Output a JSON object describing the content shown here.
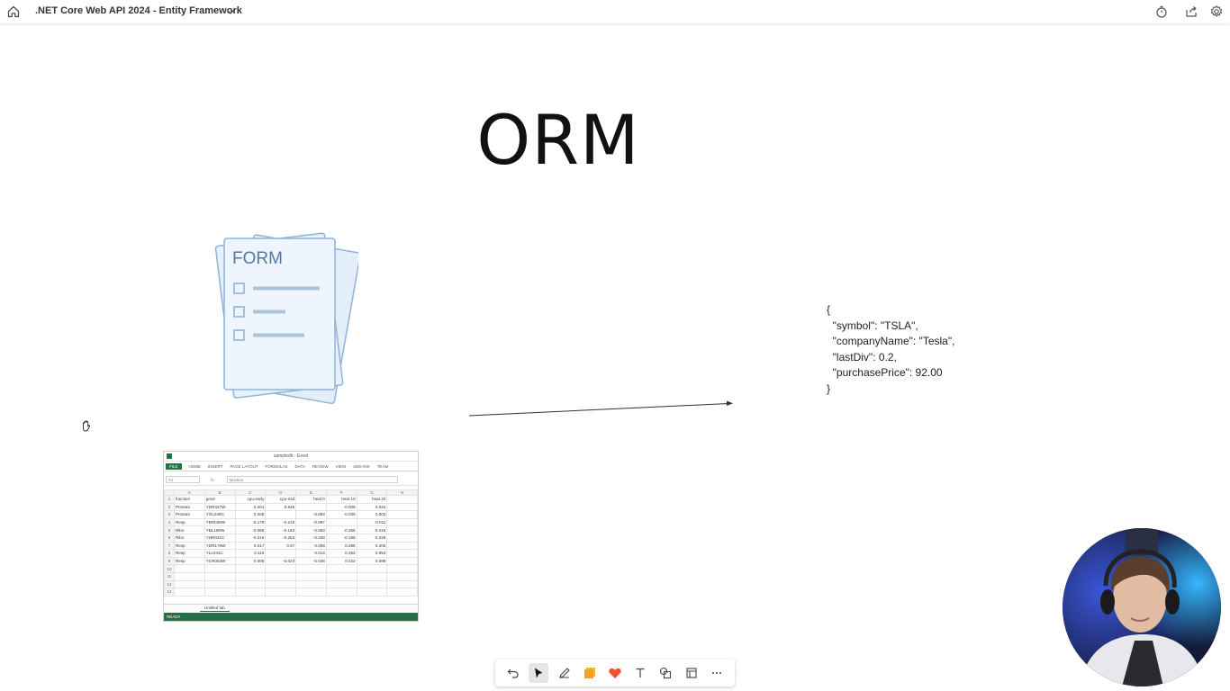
{
  "app": {
    "title": ".NET Core Web API 2024 - Entity Framework"
  },
  "icons": {
    "home": "home-icon",
    "title_dropdown": "chevron-down-icon",
    "timer": "timer-icon",
    "share": "share-icon",
    "settings": "gear-icon",
    "cursor": "hand-grab-cursor-icon"
  },
  "canvas": {
    "heading": "ORM",
    "form_illustration": {
      "label": "FORM"
    },
    "json_lines": [
      "{",
      "  \"symbol\": \"TSLA\",",
      "  \"companyName\": \"Tesla\",",
      "  \"lastDiv\": 0.2,",
      "  \"purchasePrice\": 92.00",
      "}"
    ],
    "excel": {
      "window_title": "sampledb - Excel",
      "ribbon_tabs": [
        "FILE",
        "HOME",
        "INSERT",
        "PAGE LAYOUT",
        "FORMULAS",
        "DATA",
        "REVIEW",
        "VIEW",
        "ADD-INS",
        "TEAM"
      ],
      "name_box": "A1",
      "formula": "function",
      "columns": [
        "A",
        "B",
        "C",
        "D",
        "E",
        "F",
        "G",
        "H"
      ],
      "rows": [
        [
          "function",
          "gene",
          "cpu-early",
          "cpu-mid",
          "heat 0",
          "heat 10",
          "heat 20",
          ""
        ],
        [
          "Proteas",
          "YDR427W",
          "0.201",
          "0.546",
          "",
          "-0.009",
          "0.024",
          ""
        ],
        [
          "Proteas",
          "YGL048C",
          "0.208",
          "",
          "-0.063",
          "-0.039",
          "0.003",
          ""
        ],
        [
          "Resp",
          "YBR039W",
          "-0.178",
          "-0.219",
          "-0.097",
          "",
          "-0.011",
          ""
        ],
        [
          "Ribo",
          "YBL180W",
          "-0.085",
          "-0.162",
          "-0.063",
          "-0.265",
          "-0.415",
          ""
        ],
        [
          "Ribo",
          "YHR021C",
          "-0.216",
          "-0.253",
          "-0.228",
          "-0.168",
          "-0.228",
          ""
        ],
        [
          "Resp",
          "YDR178W",
          "0.017",
          "0.07",
          "0.058",
          "0.286",
          "0.205",
          ""
        ],
        [
          "Resp",
          "YLL041C",
          "0.115",
          "",
          "0.013",
          "0.262",
          "0.054",
          ""
        ],
        [
          "Resp",
          "YCR083W",
          "0.005",
          "-0.023",
          "-0.038",
          "0.222",
          "0.088",
          ""
        ]
      ],
      "row_numbers": [
        "1",
        "2",
        "3",
        "4",
        "5",
        "6",
        "7",
        "8",
        "9",
        "10",
        "11",
        "12",
        "13"
      ],
      "sheet_tab": "Untitled tab",
      "status": "READY"
    }
  },
  "toolbar": {
    "items": [
      {
        "name": "undo-icon"
      },
      {
        "name": "select-pointer-icon"
      },
      {
        "name": "pen-icon"
      },
      {
        "name": "sticky-note-icon"
      },
      {
        "name": "heart-reaction-icon"
      },
      {
        "name": "text-icon"
      },
      {
        "name": "shapes-icon"
      },
      {
        "name": "frame-icon"
      },
      {
        "name": "more-icon"
      }
    ],
    "active_index": 1
  }
}
